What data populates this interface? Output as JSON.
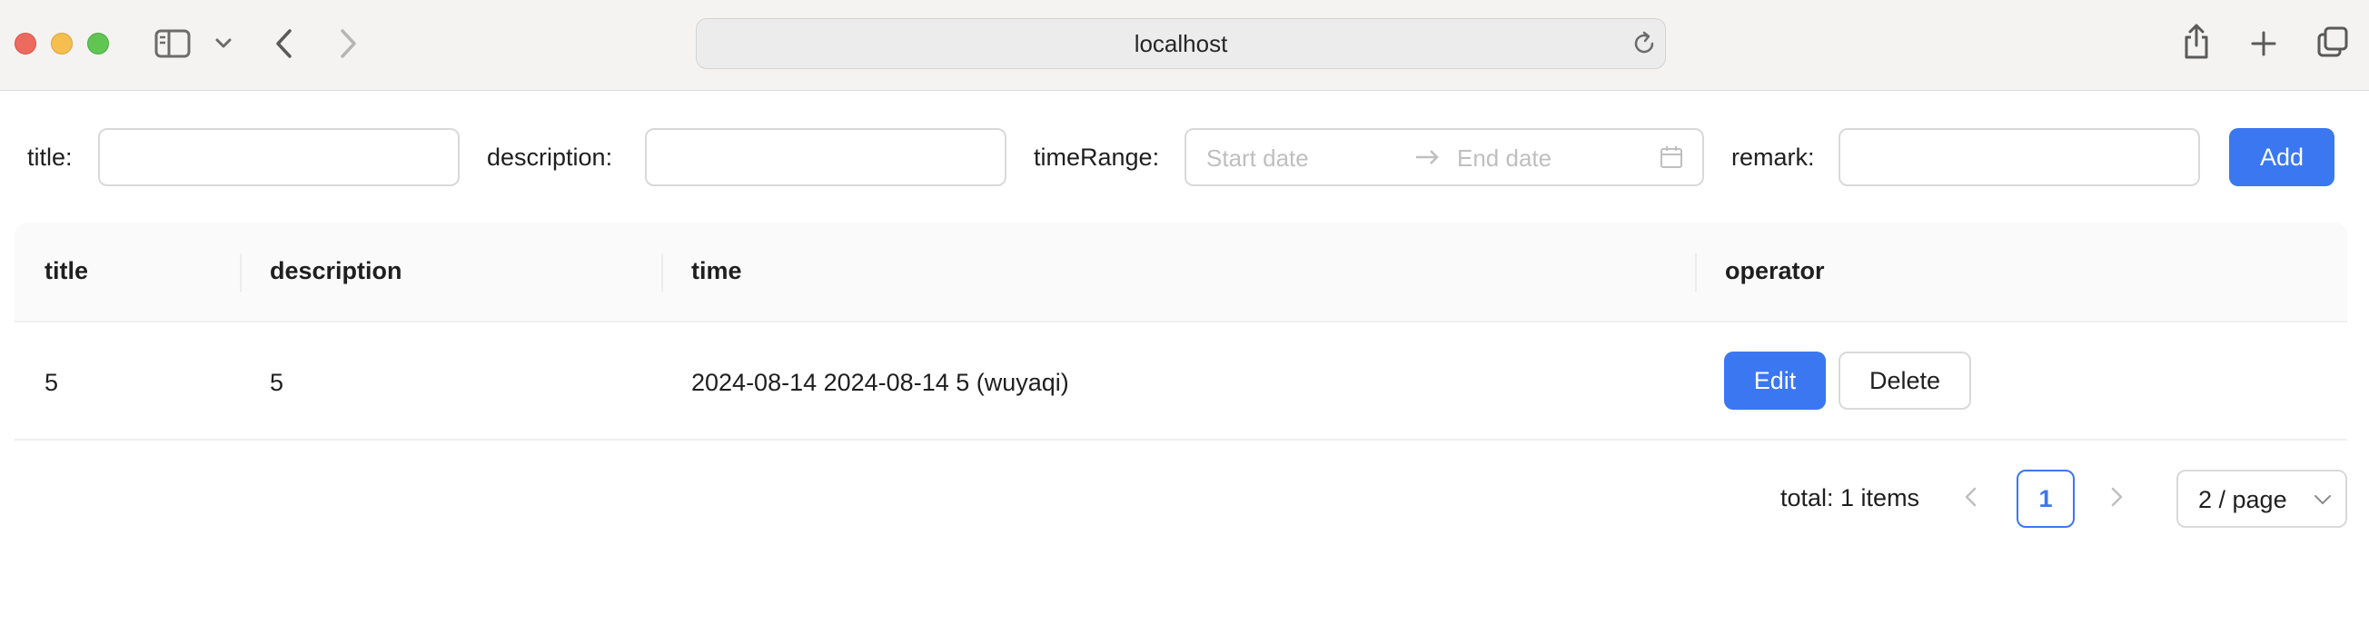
{
  "browser": {
    "url": "localhost"
  },
  "search": {
    "title_label": "title:",
    "description_label": "description:",
    "timerange_label": "timeRange:",
    "start_placeholder": "Start date",
    "end_placeholder": "End date",
    "remark_label": "remark:",
    "add_label": "Add"
  },
  "table": {
    "columns": [
      "title",
      "description",
      "time",
      "operator"
    ],
    "rows": [
      {
        "title": "5",
        "description": "5",
        "time": "2024-08-14 2024-08-14 5 (wuyaqi)",
        "edit_label": "Edit",
        "delete_label": "Delete"
      }
    ]
  },
  "pagination": {
    "total_text": "total: 1 items",
    "current_page": "1",
    "page_size_text": "2 / page"
  },
  "colors": {
    "primary": "#3b77f0",
    "border": "#d9d9d9"
  }
}
